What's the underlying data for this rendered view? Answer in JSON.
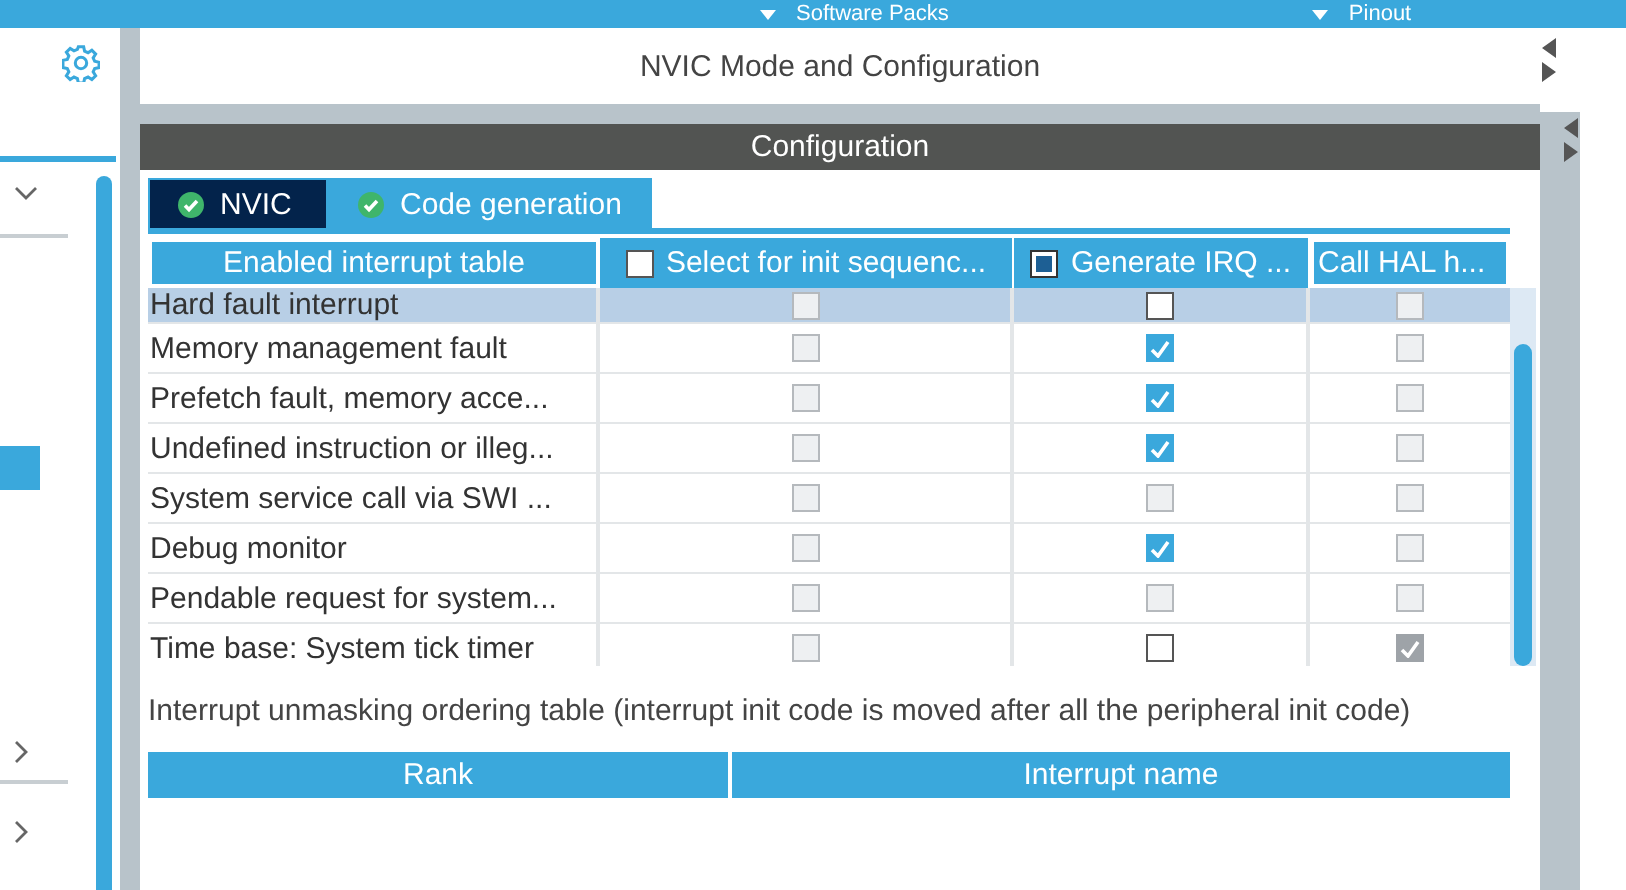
{
  "top_bar": {
    "items": [
      "Software Packs",
      "Pinout"
    ]
  },
  "header": {
    "title": "NVIC Mode and Configuration"
  },
  "configuration": {
    "title": "Configuration",
    "tabs": [
      {
        "label": "NVIC",
        "selected": false
      },
      {
        "label": "Code generation",
        "selected": true
      }
    ],
    "table": {
      "columns": [
        {
          "label": "Enabled interrupt table",
          "kind": "text"
        },
        {
          "label": "Select for init sequenc...",
          "kind": "checkbox",
          "checked": false,
          "partial": false
        },
        {
          "label": "Generate IRQ ...",
          "kind": "checkbox",
          "checked": false,
          "partial": true
        },
        {
          "label": "Call HAL h...",
          "kind": "text"
        }
      ],
      "rows": [
        {
          "name": "Hard fault interrupt",
          "selected": true,
          "cells": [
            {
              "checked": false,
              "disabled": true
            },
            {
              "checked": false,
              "disabled": false
            },
            {
              "checked": false,
              "disabled": true
            }
          ]
        },
        {
          "name": "Memory management fault",
          "selected": false,
          "cells": [
            {
              "checked": false,
              "disabled": true
            },
            {
              "checked": true,
              "disabled": false
            },
            {
              "checked": false,
              "disabled": true
            }
          ]
        },
        {
          "name": "Prefetch fault, memory acce...",
          "selected": false,
          "cells": [
            {
              "checked": false,
              "disabled": true
            },
            {
              "checked": true,
              "disabled": false
            },
            {
              "checked": false,
              "disabled": true
            }
          ]
        },
        {
          "name": "Undefined instruction or illeg...",
          "selected": false,
          "cells": [
            {
              "checked": false,
              "disabled": true
            },
            {
              "checked": true,
              "disabled": false
            },
            {
              "checked": false,
              "disabled": true
            }
          ]
        },
        {
          "name": "System service call via SWI ...",
          "selected": false,
          "cells": [
            {
              "checked": false,
              "disabled": true
            },
            {
              "checked": false,
              "disabled": true
            },
            {
              "checked": false,
              "disabled": true
            }
          ]
        },
        {
          "name": "Debug monitor",
          "selected": false,
          "cells": [
            {
              "checked": false,
              "disabled": true
            },
            {
              "checked": true,
              "disabled": false
            },
            {
              "checked": false,
              "disabled": true
            }
          ]
        },
        {
          "name": "Pendable request for system...",
          "selected": false,
          "cells": [
            {
              "checked": false,
              "disabled": true
            },
            {
              "checked": false,
              "disabled": true
            },
            {
              "checked": false,
              "disabled": true
            }
          ]
        },
        {
          "name": "Time base: System tick timer",
          "selected": false,
          "cells": [
            {
              "checked": false,
              "disabled": true
            },
            {
              "checked": false,
              "disabled": false
            },
            {
              "checked": true,
              "disabled": true
            }
          ]
        }
      ]
    },
    "note": "Interrupt unmasking ordering table (interrupt init code is moved after all the peripheral init code)",
    "ordering_table": {
      "columns": [
        "Rank",
        "Interrupt name"
      ]
    }
  }
}
